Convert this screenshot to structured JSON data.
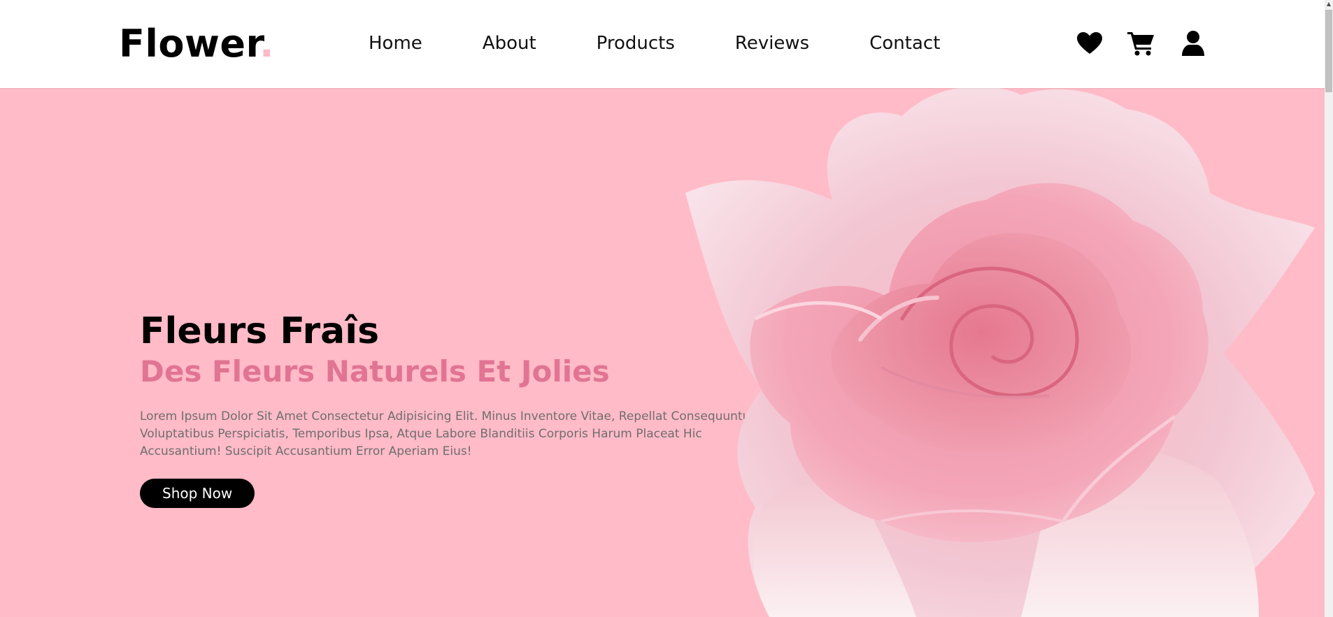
{
  "logo": {
    "text": "Flower",
    "dot": "."
  },
  "nav": {
    "items": [
      {
        "label": "Home"
      },
      {
        "label": "About"
      },
      {
        "label": "Products"
      },
      {
        "label": "Reviews"
      },
      {
        "label": "Contact"
      }
    ]
  },
  "header_icons": [
    "heart-icon",
    "cart-icon",
    "user-icon"
  ],
  "hero": {
    "title": "Fleurs Fraîs",
    "subtitle": "Des Fleurs Naturels Et Jolies",
    "description": "Lorem Ipsum Dolor Sit Amet Consectetur Adipisicing Elit. Minus Inventore Vitae, Repellat Consequuntur Voluptatibus Perspiciatis, Temporibus Ipsa, Atque Labore Blanditiis Corporis Harum Placeat Hic Accusantium! Suscipit Accusantium Error Aperiam Eius!",
    "button_label": "Shop Now"
  },
  "colors": {
    "hero_background": "#ffbbc7",
    "accent": "#e17493",
    "logo_dot": "#ffb9c9",
    "button": "#000000"
  }
}
